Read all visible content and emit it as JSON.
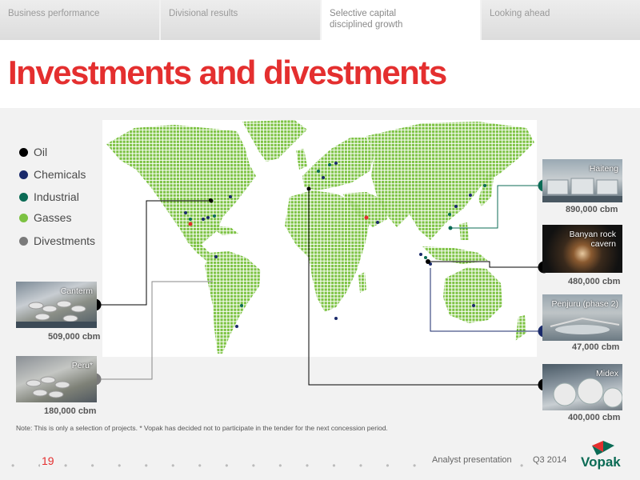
{
  "tabs": [
    {
      "label": "Business performance"
    },
    {
      "label": "Divisional results"
    },
    {
      "label": "Selective capital disciplined growth"
    },
    {
      "label": "Looking ahead"
    }
  ],
  "title": "Investments and divestments",
  "legend": [
    {
      "label": "Oil",
      "color": "#000000"
    },
    {
      "label": "Chemicals",
      "color": "#1a2a6b"
    },
    {
      "label": "Industrial",
      "color": "#0b6b55"
    },
    {
      "label": "Gasses",
      "color": "#7cc242"
    },
    {
      "label": "Divestments",
      "color": "#7a7a7a"
    }
  ],
  "projects": {
    "canterm": {
      "label": "Canterm",
      "capacity": "509,000 cbm"
    },
    "peru": {
      "label": "Peru*",
      "capacity": "180,000 cbm"
    },
    "haiteng": {
      "label": "Haiteng",
      "capacity": "890,000 cbm"
    },
    "banyan": {
      "label": "Banyan rock cavern",
      "capacity": "480,000 cbm"
    },
    "penjuru": {
      "label": "Penjuru (phase 2)",
      "capacity": "47,000 cbm"
    },
    "midex": {
      "label": "Midex",
      "capacity": "400,000 cbm"
    }
  },
  "note": "Note: This is only a selection of projects.  * Vopak has decided not to participate in the tender for the next concession period.",
  "footer": {
    "page": "19",
    "presentation": "Analyst presentation",
    "period": "Q3 2014",
    "logo_text": "Vopak"
  },
  "colors": {
    "accent": "#e42f2f",
    "land": "#7cc242"
  }
}
